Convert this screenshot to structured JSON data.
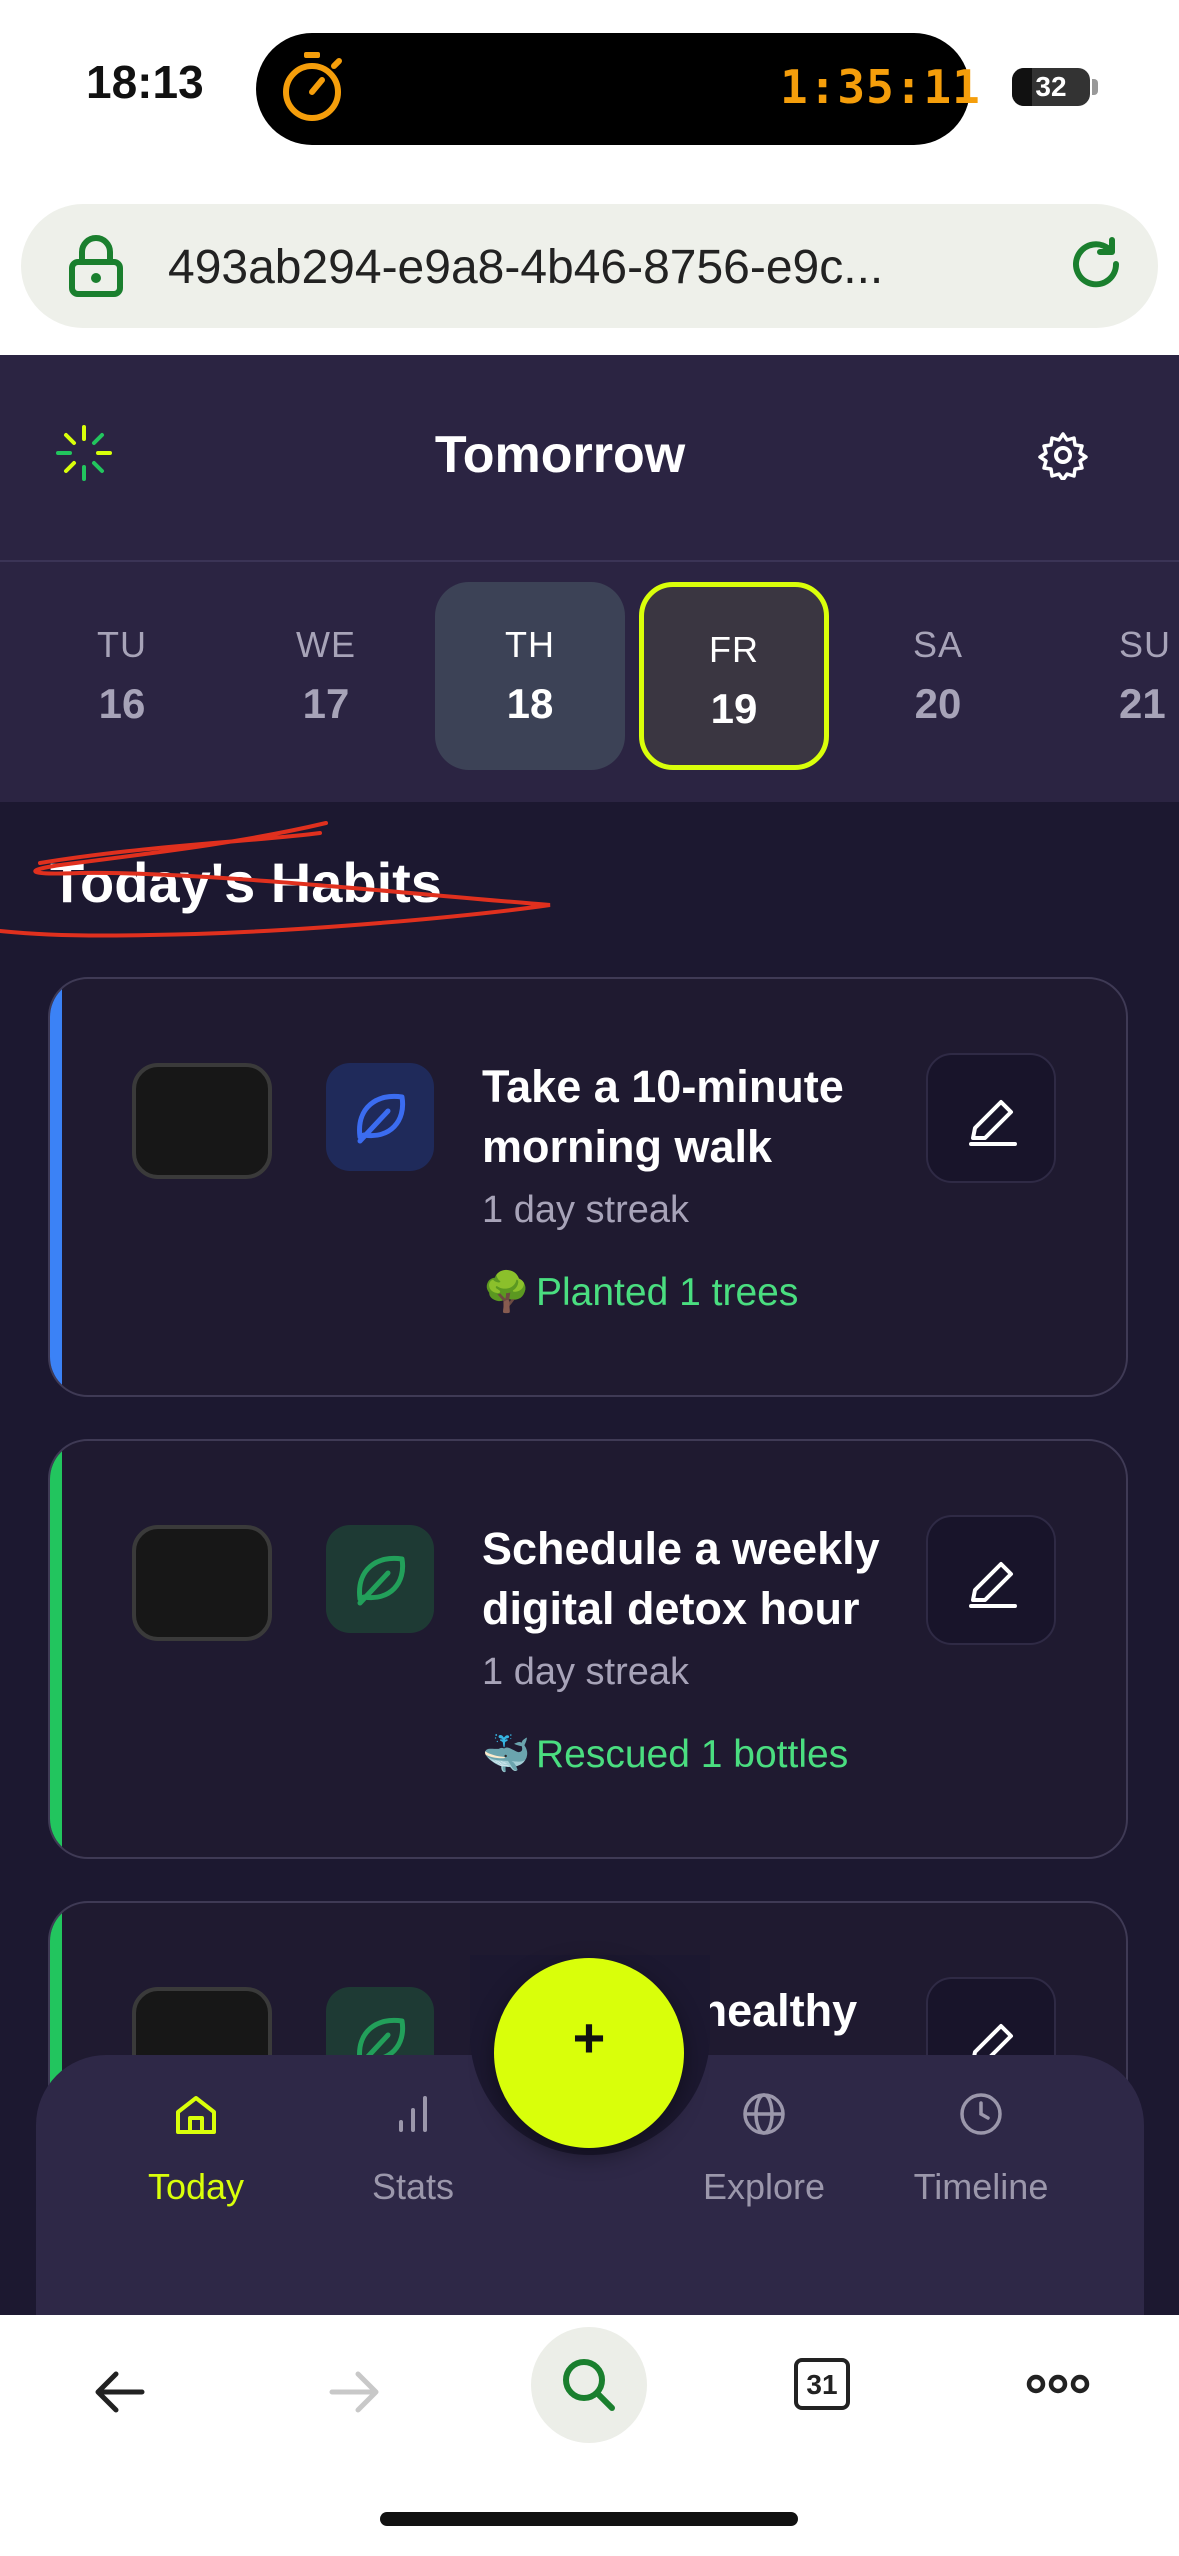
{
  "status_bar": {
    "time": "18:13",
    "timer": "1:35:11",
    "battery": "32"
  },
  "browser": {
    "url": "493ab294-e9a8-4b46-8756-e9c..."
  },
  "header": {
    "title": "Tomorrow"
  },
  "week": [
    {
      "name": "TU",
      "date": "16"
    },
    {
      "name": "WE",
      "date": "17"
    },
    {
      "name": "TH",
      "date": "18"
    },
    {
      "name": "FR",
      "date": "19"
    },
    {
      "name": "SA",
      "date": "20"
    },
    {
      "name": "SU",
      "date": "21"
    }
  ],
  "section_title": "Today's Habits",
  "habits": [
    {
      "title": "Take a 10-minute morning walk",
      "streak": "1 day streak",
      "impact_emoji": "🌳",
      "impact": "Planted 1 trees",
      "accent": "#3b82f6"
    },
    {
      "title": "Schedule a weekly digital detox hour",
      "streak": "1 day streak",
      "impact_emoji": "🐳",
      "impact": "Rescued 1 bottles",
      "accent": "#22c55e"
    },
    {
      "title": "Prepare a healthy",
      "accent": "#22c55e"
    }
  ],
  "fab": {
    "label": "+"
  },
  "tabs": [
    {
      "label": "Today",
      "icon": "home-icon",
      "active": true
    },
    {
      "label": "Stats",
      "icon": "chart-icon"
    },
    {
      "label": "Explore",
      "icon": "globe-icon"
    },
    {
      "label": "Timeline",
      "icon": "clock-icon"
    }
  ],
  "browser_nav": {
    "calendar_label": "31"
  },
  "colors": {
    "accent": "#d9ff0a",
    "background": "#1c1830",
    "success": "#4ade80"
  }
}
